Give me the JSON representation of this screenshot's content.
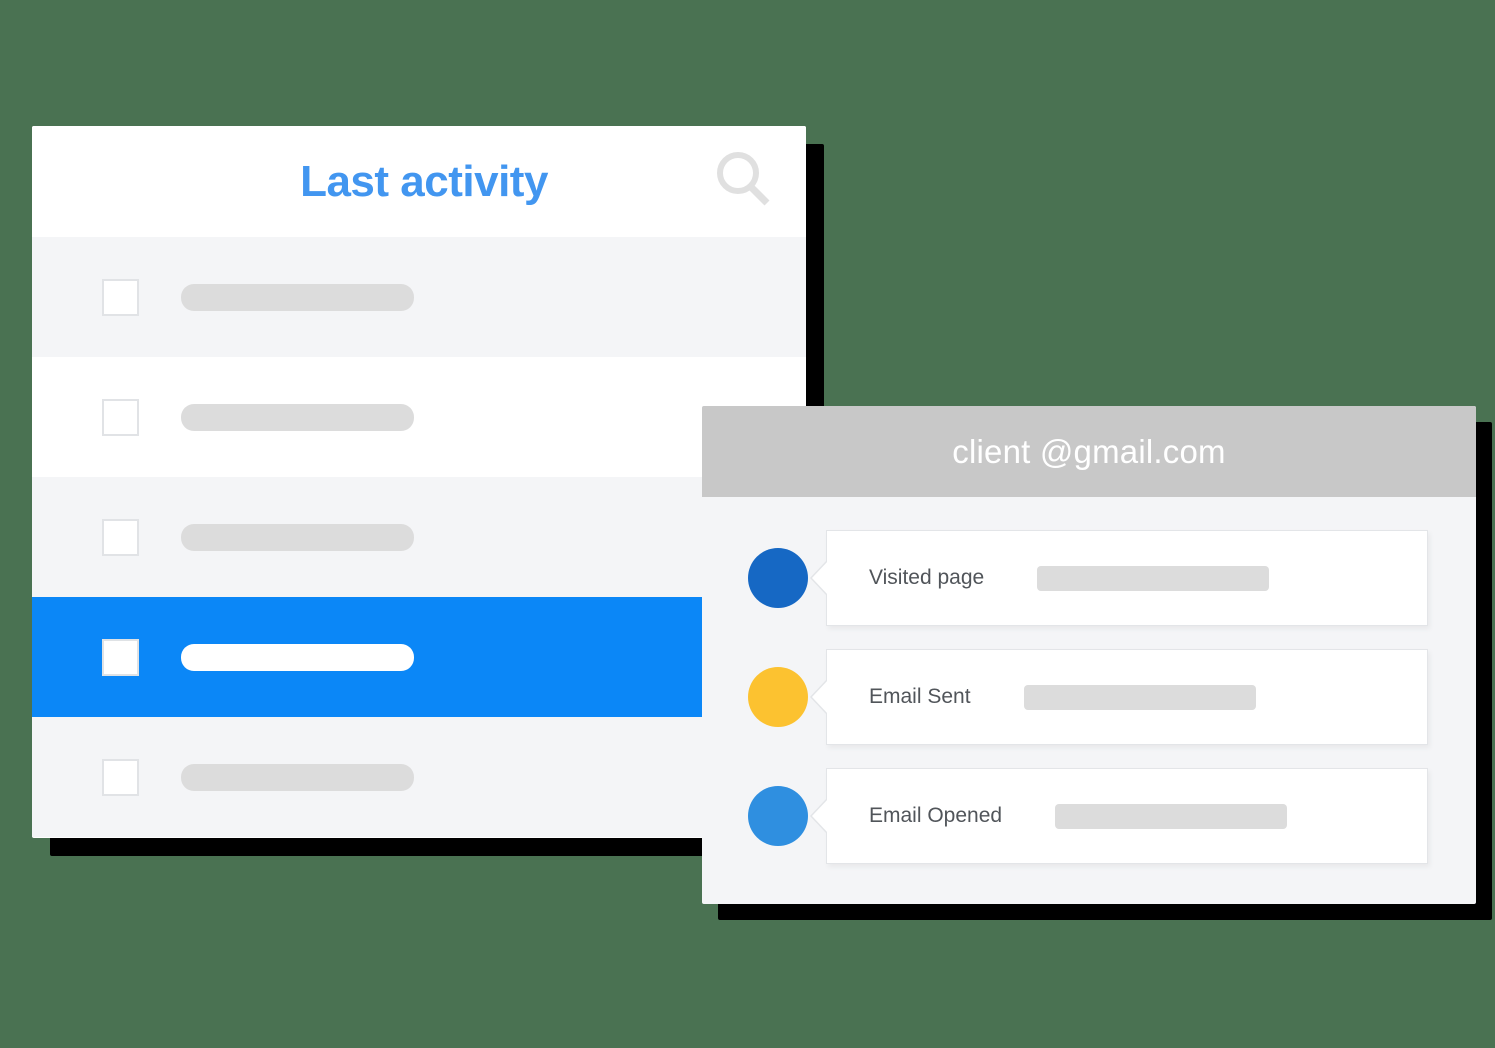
{
  "theme": {
    "background": "#4a7252",
    "accent_blue": "#0b87f7",
    "title_blue": "#4296f0",
    "row_light": "#f4f5f7",
    "row_white": "#ffffff",
    "placeholder_gray": "#dcdcdc",
    "header_gray": "#c8c8c8"
  },
  "activity_panel": {
    "title": "Last activity",
    "search_icon": "search-icon",
    "rows": [
      {
        "shade": "light",
        "checked": false,
        "placeholder_label": ""
      },
      {
        "shade": "white",
        "checked": false,
        "placeholder_label": ""
      },
      {
        "shade": "light",
        "checked": false,
        "placeholder_label": ""
      },
      {
        "shade": "selected",
        "checked": false,
        "placeholder_label": ""
      },
      {
        "shade": "light",
        "checked": false,
        "placeholder_label": ""
      }
    ]
  },
  "client_panel": {
    "email": "client @gmail.com",
    "timeline": [
      {
        "label": "Visited page",
        "dot_color": "#1668c4",
        "dot_name": "status-dot-visited-page"
      },
      {
        "label": "Email Sent",
        "dot_color": "#fcc230",
        "dot_name": "status-dot-email-sent"
      },
      {
        "label": "Email Opened",
        "dot_color": "#2f8fe0",
        "dot_name": "status-dot-email-opened"
      }
    ]
  }
}
